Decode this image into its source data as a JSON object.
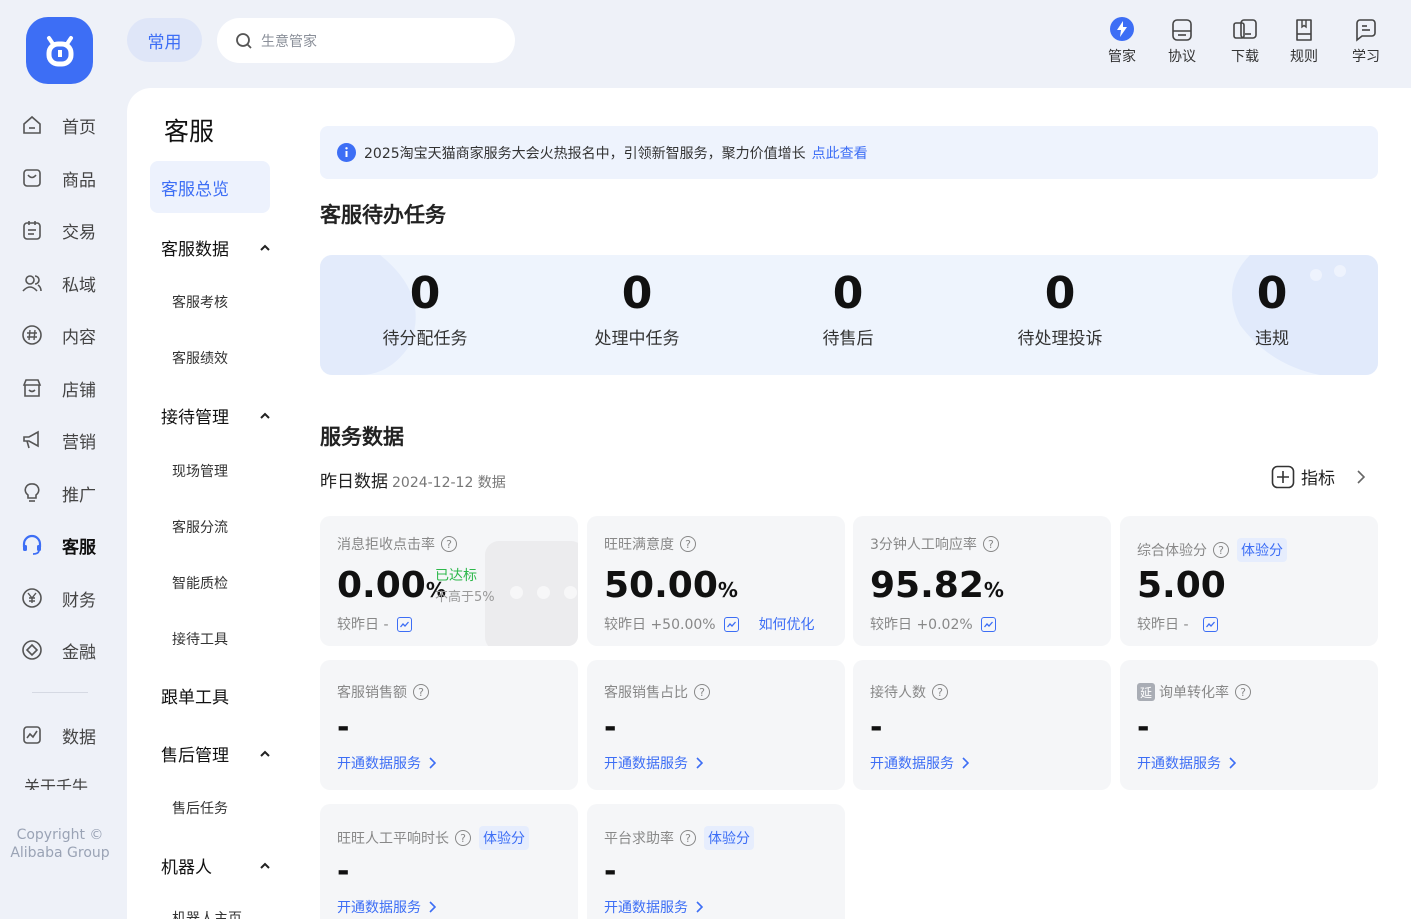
{
  "top": {
    "pill_label": "常用",
    "search_placeholder": "生意管家",
    "tools": [
      {
        "label": "管家",
        "icon": "lightning-icon"
      },
      {
        "label": "协议",
        "icon": "agreement-icon"
      },
      {
        "label": "下载",
        "icon": "download-icon"
      },
      {
        "label": "规则",
        "icon": "rules-book-icon"
      },
      {
        "label": "学习",
        "icon": "learn-icon"
      }
    ]
  },
  "nav": {
    "items": [
      {
        "label": "首页",
        "icon": "home-icon"
      },
      {
        "label": "商品",
        "icon": "goods-icon"
      },
      {
        "label": "交易",
        "icon": "trade-icon"
      },
      {
        "label": "私域",
        "icon": "users-icon"
      },
      {
        "label": "内容",
        "icon": "hashtag-icon"
      },
      {
        "label": "店铺",
        "icon": "store-icon"
      },
      {
        "label": "营销",
        "icon": "megaphone-icon"
      },
      {
        "label": "推广",
        "icon": "bulb-icon"
      },
      {
        "label": "客服",
        "icon": "headset-icon"
      },
      {
        "label": "财务",
        "icon": "yuan-icon"
      },
      {
        "label": "金融",
        "icon": "finance-icon"
      },
      {
        "label": "数据",
        "icon": "chart-icon"
      }
    ],
    "about": "关于千牛",
    "copyright": "Copyright © Alibaba Group"
  },
  "sub": {
    "title": "客服",
    "active": "客服总览",
    "groups": [
      {
        "label": "客服数据",
        "items": [
          "客服考核",
          "客服绩效"
        ]
      },
      {
        "label": "接待管理",
        "items": [
          "现场管理",
          "客服分流",
          "智能质检",
          "接待工具"
        ]
      },
      {
        "label": "跟单工具",
        "items": []
      },
      {
        "label": "售后管理",
        "items": [
          "售后任务"
        ]
      },
      {
        "label": "机器人",
        "items": [
          "机器人主页"
        ]
      }
    ]
  },
  "notice": {
    "text": "2025淘宝天猫商家服务大会火热报名中，引领新智服务，聚力价值增长",
    "link": "点此查看"
  },
  "tasks": {
    "title": "客服待办任务",
    "items": [
      {
        "num": "0",
        "label": "待分配任务"
      },
      {
        "num": "0",
        "label": "处理中任务"
      },
      {
        "num": "0",
        "label": "待售后"
      },
      {
        "num": "0",
        "label": "待处理投诉"
      },
      {
        "num": "0",
        "label": "违规"
      }
    ]
  },
  "service": {
    "title": "服务数据",
    "subtitle": "昨日数据",
    "date": "2024-12-12 数据",
    "metric_btn": "指标",
    "cards": [
      {
        "title": "消息拒收点击率",
        "value": "0.00",
        "unit": "%",
        "cmp": "较昨日 -",
        "status": "已达标",
        "status_note": "不高于5%"
      },
      {
        "title": "旺旺满意度",
        "value": "50.00",
        "unit": "%",
        "cmp": "较昨日 +50.00%",
        "link": "如何优化"
      },
      {
        "title": "3分钟人工响应率",
        "value": "95.82",
        "unit": "%",
        "cmp": "较昨日 +0.02%"
      },
      {
        "title": "综合体验分",
        "tag": "体验分",
        "value": "5.00",
        "unit": "",
        "cmp": "较昨日 -"
      },
      {
        "title": "客服销售额",
        "dash": "-",
        "open": "开通数据服务"
      },
      {
        "title": "客服销售占比",
        "dash": "-",
        "open": "开通数据服务"
      },
      {
        "title": "接待人数",
        "dash": "-",
        "open": "开通数据服务"
      },
      {
        "title": "询单转化率",
        "badge": "延",
        "dash": "-",
        "open": "开通数据服务"
      },
      {
        "title": "旺旺人工平响时长",
        "tag": "体验分",
        "dash": "-",
        "open": "开通数据服务"
      },
      {
        "title": "平台求助率",
        "tag": "体验分",
        "dash": "-",
        "open": "开通数据服务"
      }
    ]
  },
  "colors": {
    "accent": "#3d6ef5",
    "bg": "#eef1f8",
    "card": "#f5f6f8",
    "success": "#2eb84b"
  }
}
